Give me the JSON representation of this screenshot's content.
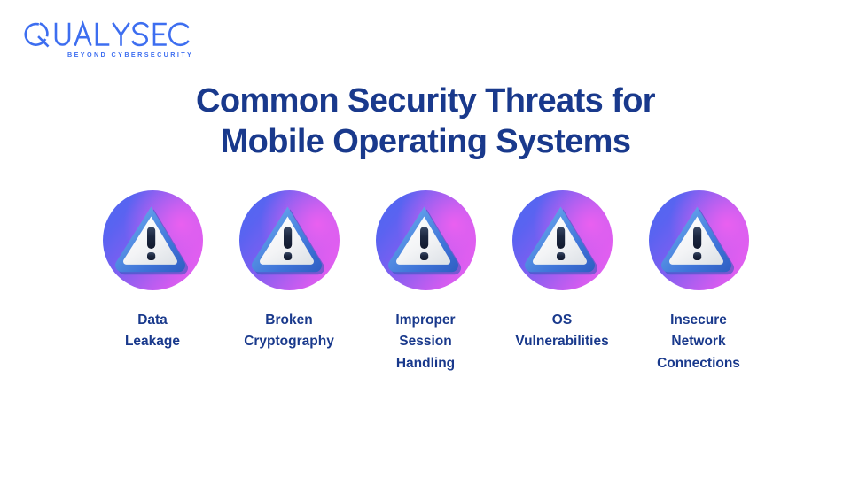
{
  "brand": {
    "name": "QUALYSEC",
    "tagline": "BEYOND CYBERSECURITY",
    "logo_color": "#3d6ef0"
  },
  "title": {
    "line1": "Common Security Threats for",
    "line2": "Mobile Operating Systems",
    "color": "#19398c"
  },
  "theme": {
    "background": "#ffffff",
    "text_navy": "#19398c",
    "gradient_start": "#4b6bf2",
    "gradient_mid": "#a75ef0",
    "gradient_end": "#e96bee",
    "triangle_border": "#4a86e8",
    "triangle_fill": "#f2f3f5"
  },
  "threats": [
    {
      "icon": "warning-triangle-icon",
      "label": "Data\nLeakage"
    },
    {
      "icon": "warning-triangle-icon",
      "label": "Broken\nCryptography"
    },
    {
      "icon": "warning-triangle-icon",
      "label": "Improper\nSession\nHandling"
    },
    {
      "icon": "warning-triangle-icon",
      "label": "OS\nVulnerabilities"
    },
    {
      "icon": "warning-triangle-icon",
      "label": "Insecure\nNetwork\nConnections"
    }
  ]
}
